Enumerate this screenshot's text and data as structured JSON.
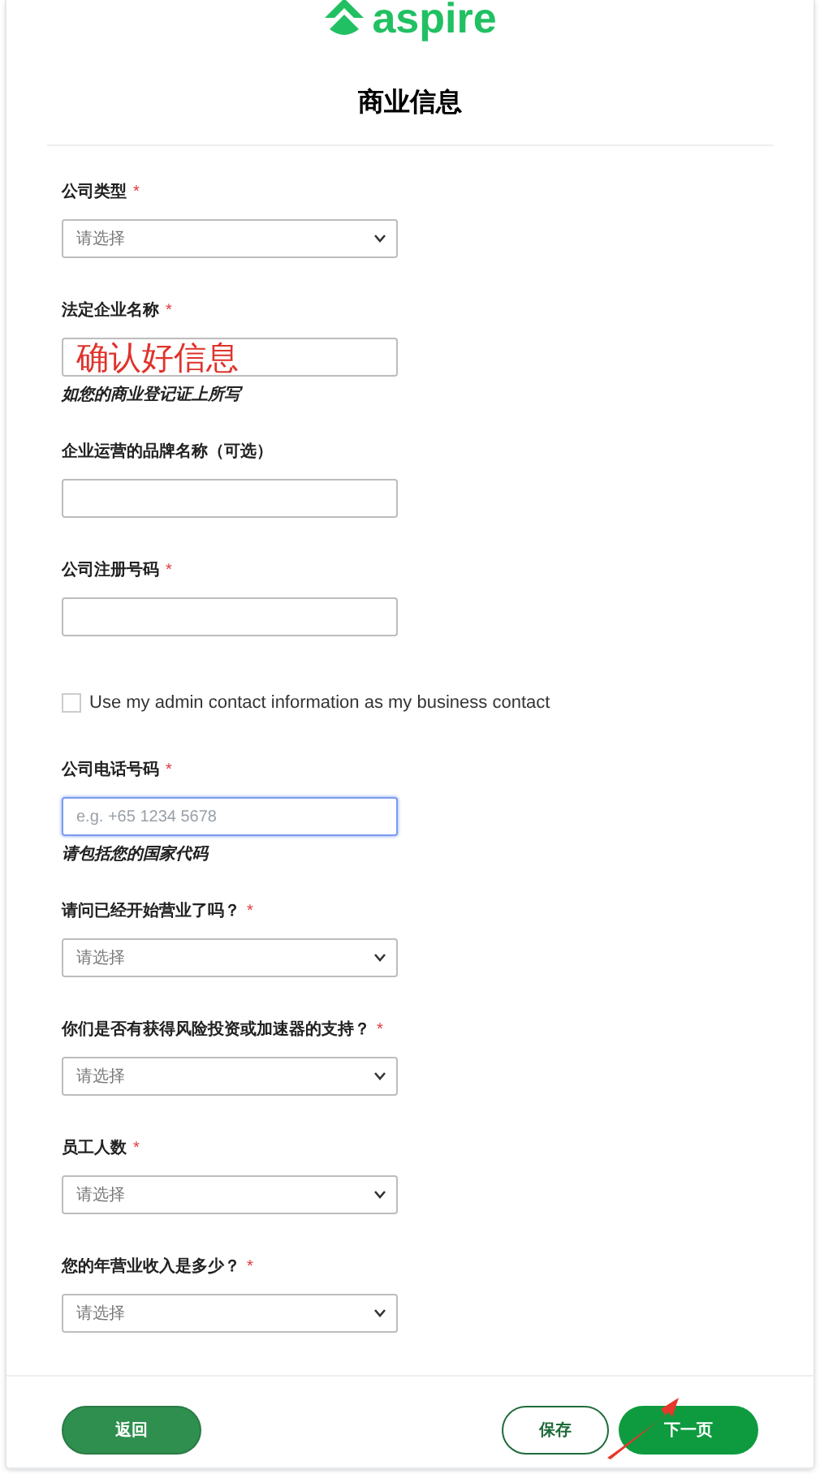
{
  "logo": {
    "text": "aspire"
  },
  "title": "商业信息",
  "fields": [
    {
      "kind": "select",
      "label": "公司类型",
      "mark": "*",
      "placeholder": "请选择"
    },
    {
      "kind": "text",
      "label": "法定企业名称",
      "mark": "*",
      "value": "确认好信息",
      "hint": "如您的商业登记证上所写"
    },
    {
      "kind": "text",
      "label": "企业运营的品牌名称（可选）"
    },
    {
      "kind": "text",
      "label": "公司注册号码",
      "mark": "*"
    },
    {
      "kind": "checkbox",
      "label": "Use my admin contact information as my business contact",
      "checked": false
    },
    {
      "kind": "text",
      "label": "公司电话号码",
      "mark": "*",
      "placeholder": "e.g. +65 1234 5678",
      "focused": true,
      "hint": "请包括您的国家代码"
    },
    {
      "kind": "select",
      "label": "请问已经开始营业了吗？",
      "mark": "*",
      "placeholder": "请选择"
    },
    {
      "kind": "select",
      "label": "你们是否有获得风险投资或加速器的支持？",
      "mark": "*",
      "placeholder": "请选择"
    },
    {
      "kind": "select",
      "label": "员工人数",
      "mark": "*",
      "placeholder": "请选择"
    },
    {
      "kind": "select",
      "label": "您的年营业收入是多少？",
      "mark": "*",
      "placeholder": "请选择"
    }
  ],
  "buttons": [
    {
      "kind": "filled",
      "label": "返回"
    },
    {
      "kind": "outline",
      "label": "保存"
    },
    {
      "kind": "primary",
      "label": "下一页"
    }
  ]
}
